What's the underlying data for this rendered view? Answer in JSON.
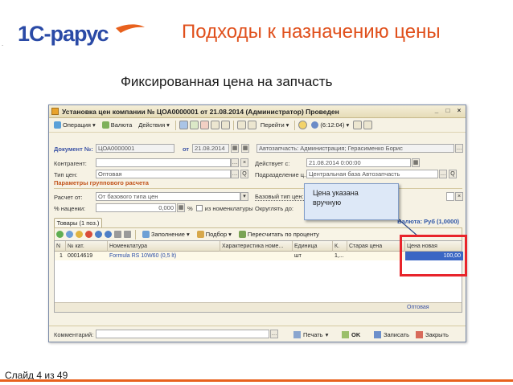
{
  "slide": {
    "logo_text": "1С-рарус",
    "title": "Подходы к назначению цены",
    "subtitle": "Фиксированная цена на запчасть",
    "footer": "Слайд 4 из 49",
    "accent_color": "#e0501c"
  },
  "window": {
    "title": "Установка цен компании № ЦОА0000001 от 21.08.2014 (Администратор) Проведен",
    "toolbar": {
      "operation": "Операция",
      "currency": "Валюта",
      "actions": "Действия",
      "goto": "Перейти",
      "time": "(6:12:04)"
    },
    "document": {
      "label": "Документ №:",
      "number": "ЦОА0000001",
      "date_label": "от",
      "date": "21.08.2014",
      "author": "Автозапчасть: Администрация; Герасименко Борис"
    },
    "fields": {
      "contractor_label": "Контрагент:",
      "contractor_value": "",
      "valid_from_label": "Действует с:",
      "valid_from_value": "21.08.2014 0:00:00",
      "price_type_label": "Тип цен:",
      "price_type_value": "Оптовая",
      "division_label": "Подразделение ц...",
      "division_value": "Центральная база Автозапчасть"
    },
    "group_section": {
      "title": "Параметры группового расчета",
      "calc_from_label": "Расчет от:",
      "calc_from_value": "От базового типа цен",
      "base_type_label": "Базовый тип цен:",
      "markup_label": "% наценки:",
      "markup_value": "0,000",
      "from_nomenclature": "из номенклатуры",
      "round_label": "Округлять до:"
    },
    "tab_label": "Товары (1 поз.)",
    "currency_info": "Валюта: Руб (1,0000)",
    "grid_toolbar": {
      "fill": "Заполнение",
      "select": "Подбор",
      "recalc": "Пересчитать по проценту"
    },
    "grid": {
      "headers": [
        "N",
        "№ кат.",
        "Номенклатура",
        "Характеристика номе...",
        "Единица",
        "К.",
        "Старая цена",
        "Цена новая"
      ],
      "rows": [
        [
          "1",
          "00014619",
          "Formula RS 10W60 (0,5 lt)",
          "",
          "шт",
          "1,...",
          "",
          "100,00"
        ]
      ],
      "footer": "Оптовая"
    },
    "comment_label": "Комментарий:",
    "bottom_buttons": {
      "print": "Печать",
      "ok": "OK",
      "save": "Записать",
      "close": "Закрыть"
    }
  },
  "callout": {
    "text_line1": "Цена указана",
    "text_line2": "вручную"
  }
}
